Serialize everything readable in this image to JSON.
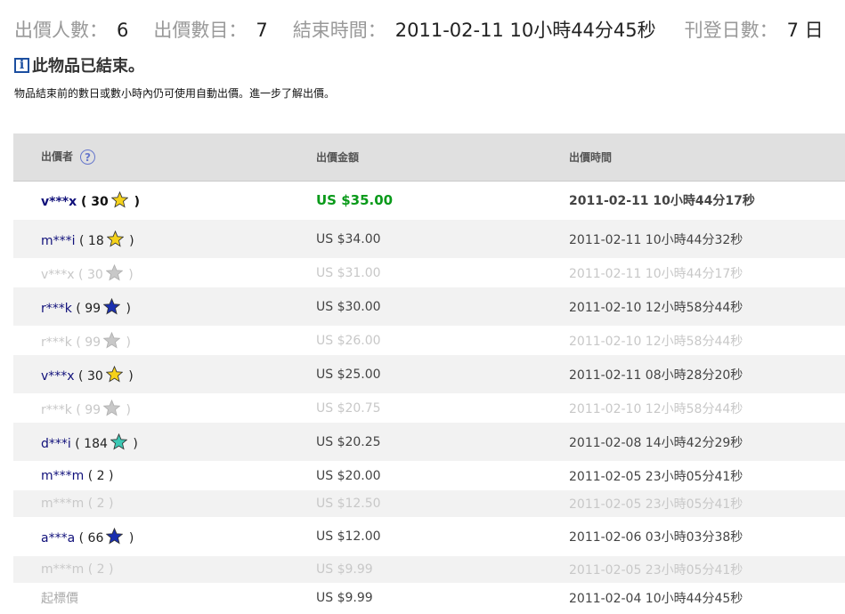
{
  "summary": {
    "bids_label": "出價人數：",
    "bids_value": "6",
    "count_label": "出價數目：",
    "count_value": "7",
    "end_label": "結束時間：",
    "end_value": "2011-02-11 10小時44分45秒",
    "duration_label": "刊登日數：",
    "duration_value": "7 日"
  },
  "notice": {
    "icon": "info-icon",
    "title": "此物品已結束。",
    "text": "物品結束前的數日或數小時內仍可使用自動出價。進一步了解",
    "link": "出價",
    "suffix": "。"
  },
  "table": {
    "headers": [
      "出價者",
      "出價金額",
      "出價時間"
    ],
    "help_glyph": "?",
    "rows": [
      {
        "name": "v***x",
        "open": " ( ",
        "score": "30",
        "star": "yellow",
        "close": " )",
        "amount": "US $35.00",
        "time": "2011-02-11 10小時44分17秒",
        "state": "winner",
        "shade": false
      },
      {
        "name": "m***i",
        "open": " ( ",
        "score": "18",
        "star": "yellow",
        "close": " )",
        "amount": "US $34.00",
        "time": "2011-02-11 10小時44分32秒",
        "state": "normal",
        "shade": true
      },
      {
        "name": "v***x",
        "open": " ( ",
        "score": "30",
        "star": "gray",
        "close": " )",
        "amount": "US $31.00",
        "time": "2011-02-11 10小時44分17秒",
        "state": "retracted",
        "shade": false
      },
      {
        "name": "r***k",
        "open": " ( ",
        "score": "99",
        "star": "blue",
        "close": " )",
        "amount": "US $30.00",
        "time": "2011-02-10 12小時58分44秒",
        "state": "normal",
        "shade": true
      },
      {
        "name": "r***k",
        "open": " ( ",
        "score": "99",
        "star": "gray",
        "close": " )",
        "amount": "US $26.00",
        "time": "2011-02-10 12小時58分44秒",
        "state": "retracted",
        "shade": false
      },
      {
        "name": "v***x",
        "open": " ( ",
        "score": "30",
        "star": "yellow",
        "close": " )",
        "amount": "US $25.00",
        "time": "2011-02-11 08小時28分20秒",
        "state": "normal",
        "shade": true
      },
      {
        "name": "r***k",
        "open": " ( ",
        "score": "99",
        "star": "gray",
        "close": " )",
        "amount": "US $20.75",
        "time": "2011-02-10 12小時58分44秒",
        "state": "retracted",
        "shade": false
      },
      {
        "name": "d***i",
        "open": " ( ",
        "score": "184",
        "star": "turquoise",
        "close": " )",
        "amount": "US $20.25",
        "time": "2011-02-08 14小時42分29秒",
        "state": "normal",
        "shade": true
      },
      {
        "name": "m***m",
        "open": " ( ",
        "score": "2",
        "star": "",
        "close": " )",
        "amount": "US $20.00",
        "time": "2011-02-05 23小時05分41秒",
        "state": "normal",
        "shade": false
      },
      {
        "name": "m***m",
        "open": " ( ",
        "score": "2",
        "star": "",
        "close": " )",
        "amount": "US $12.50",
        "time": "2011-02-05 23小時05分41秒",
        "state": "retracted",
        "shade": true
      },
      {
        "name": "a***a",
        "open": " ( ",
        "score": "66",
        "star": "blue",
        "close": " )",
        "amount": "US $12.00",
        "time": "2011-02-06 03小時03分38秒",
        "state": "normal",
        "shade": false
      },
      {
        "name": "m***m",
        "open": " ( ",
        "score": "2",
        "star": "",
        "close": " )",
        "amount": "US $9.99",
        "time": "2011-02-05 23小時05分41秒",
        "state": "retracted",
        "shade": true
      }
    ],
    "starting": {
      "label": "起標價",
      "amount": "US $9.99",
      "time": "2011-02-04 10小時44分45秒"
    }
  },
  "colors": {
    "winner_amount": "#0a9a1a",
    "bidder_name": "#10107a",
    "retracted_text": "#c8c8c8",
    "header_bg": "#e0e0e0",
    "alt_row_bg": "#f2f2f2",
    "star_yellow": "#f5d21a",
    "star_blue": "#1a2fb0",
    "star_turquoise": "#3cc8b4",
    "star_gray": "#c8c8c8"
  }
}
